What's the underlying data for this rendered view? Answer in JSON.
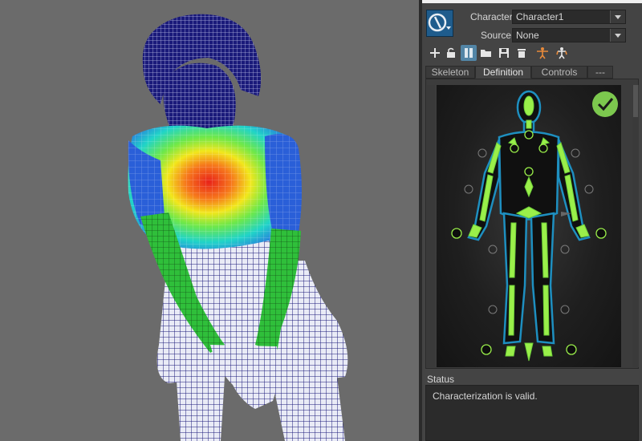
{
  "header": {
    "character_label": "Character:",
    "character_value": "Character1",
    "source_label": "Source:",
    "source_value": "None"
  },
  "toolbar": {
    "icons": [
      "plus-icon",
      "lock-icon",
      "definition-mode-icon",
      "folder-open-icon",
      "save-icon",
      "trash-icon",
      "tpose-icon",
      "stance-icon"
    ]
  },
  "tabs": [
    {
      "label": "Skeleton",
      "active": false
    },
    {
      "label": "Definition",
      "active": true
    },
    {
      "label": "Controls",
      "active": false
    },
    {
      "label": "---",
      "active": false
    }
  ],
  "definition": {
    "valid": true,
    "colors": {
      "bone": "#9aef4a",
      "outline": "#1e8fc0",
      "check": "#7cc84e"
    }
  },
  "status": {
    "label": "Status",
    "message": "Characterization is valid."
  }
}
